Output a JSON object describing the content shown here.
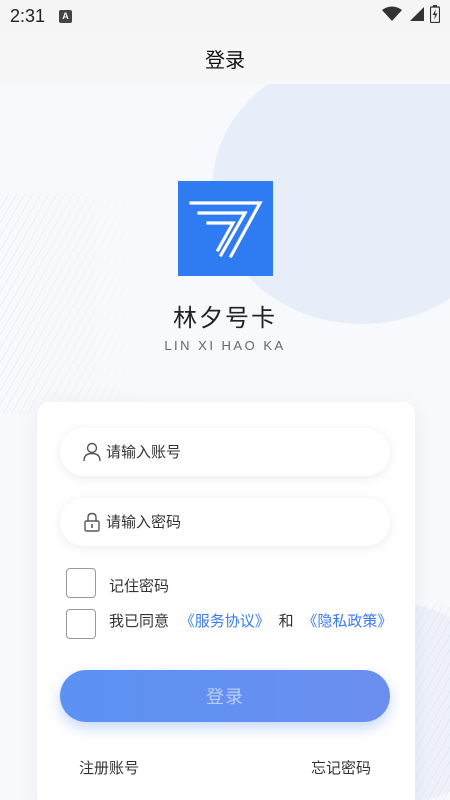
{
  "status_bar": {
    "time": "2:31",
    "notification_icon": "a-notification-icon",
    "wifi_icon": "wifi-icon",
    "signal_icon": "signal-icon",
    "battery_icon": "battery-icon"
  },
  "nav": {
    "title": "登录"
  },
  "app": {
    "name": "林夕号卡",
    "subtitle": "LIN XI HAO KA",
    "logo_color": "#2f7bf2"
  },
  "form": {
    "account_placeholder": "请输入账号",
    "password_placeholder": "请输入密码",
    "remember_label": "记住密码",
    "agree_prefix": "我已同意",
    "service_link": "《服务协议》",
    "and_text": "和",
    "privacy_link": "《隐私政策》",
    "login_button": "登录"
  },
  "links": {
    "register": "注册账号",
    "forgot": "忘记密码"
  },
  "colors": {
    "accent": "#3a7bf0",
    "button_gradient_start": "#5b92f4",
    "button_gradient_end": "#6b8ff0"
  }
}
